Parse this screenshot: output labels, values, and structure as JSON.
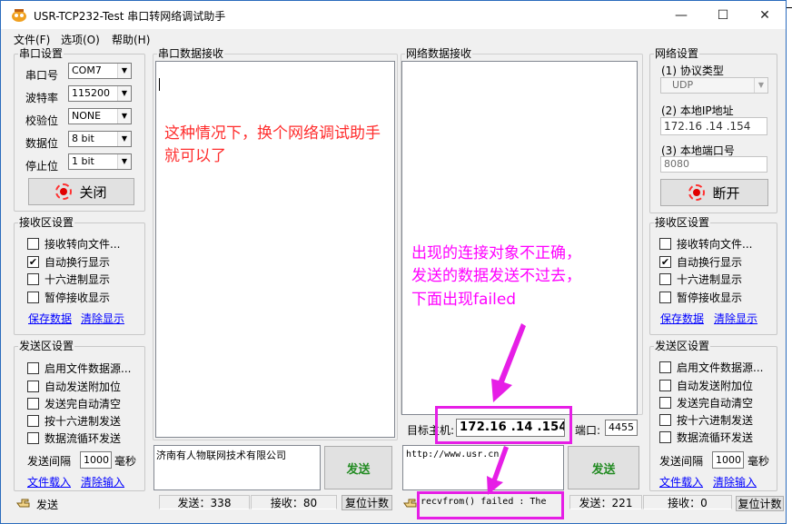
{
  "window": {
    "title": "USR-TCP232-Test 串口转网络调试助手",
    "minimize": "—",
    "maximize": "☐",
    "close": "✕"
  },
  "menu": [
    "文件(F)",
    "选项(O)",
    "帮助(H)"
  ],
  "serial_settings": {
    "legend": "串口设置",
    "rows": [
      {
        "label": "串口号",
        "value": "COM7"
      },
      {
        "label": "波特率",
        "value": "115200"
      },
      {
        "label": "校验位",
        "value": "NONE"
      },
      {
        "label": "数据位",
        "value": "8 bit"
      },
      {
        "label": "停止位",
        "value": "1 bit"
      }
    ],
    "close_button": "关闭"
  },
  "left_receive": {
    "legend": "接收区设置",
    "options": [
      {
        "label": "接收转向文件...",
        "checked": false
      },
      {
        "label": "自动换行显示",
        "checked": true
      },
      {
        "label": "十六进制显示",
        "checked": false
      },
      {
        "label": "暂停接收显示",
        "checked": false
      }
    ],
    "save_link": "保存数据",
    "clear_link": "清除显示"
  },
  "left_send": {
    "legend": "发送区设置",
    "options": [
      {
        "label": "启用文件数据源...",
        "checked": false
      },
      {
        "label": "自动发送附加位",
        "checked": false
      },
      {
        "label": "发送完自动清空",
        "checked": false
      },
      {
        "label": "按十六进制发送",
        "checked": false
      },
      {
        "label": "数据流循环发送",
        "checked": false
      }
    ],
    "interval_label": "发送间隔",
    "interval_value": "1000",
    "interval_unit": "毫秒",
    "load_link": "文件载入",
    "clear_link": "清除输入"
  },
  "serial_receive": {
    "legend": "串口数据接收"
  },
  "net_receive": {
    "legend": "网络数据接收"
  },
  "serial_send": {
    "text": "济南有人物联网技术有限公司",
    "button": "发送"
  },
  "net_send": {
    "text": "http://www.usr.cn",
    "button": "发送"
  },
  "target": {
    "label": "目标主机:",
    "ip": "172.16 .14 .154",
    "port_label": "端口:",
    "port": "4455"
  },
  "net_settings": {
    "legend": "网络设置",
    "protocol_label": "(1) 协议类型",
    "protocol": "UDP",
    "ip_label": "(2) 本地IP地址",
    "ip": "172.16 .14 .154",
    "port_label": "(3) 本地端口号",
    "port": "8080",
    "disconnect_button": "断开"
  },
  "right_receive": {
    "legend": "接收区设置",
    "options": [
      {
        "label": "接收转向文件...",
        "checked": false
      },
      {
        "label": "自动换行显示",
        "checked": true
      },
      {
        "label": "十六进制显示",
        "checked": false
      },
      {
        "label": "暂停接收显示",
        "checked": false
      }
    ],
    "save_link": "保存数据",
    "clear_link": "清除显示"
  },
  "right_send": {
    "legend": "发送区设置",
    "options": [
      {
        "label": "启用文件数据源...",
        "checked": false
      },
      {
        "label": "自动发送附加位",
        "checked": false
      },
      {
        "label": "发送完自动清空",
        "checked": false
      },
      {
        "label": "按十六进制发送",
        "checked": false
      },
      {
        "label": "数据流循环发送",
        "checked": false
      }
    ],
    "interval_label": "发送间隔",
    "interval_value": "1000",
    "interval_unit": "毫秒",
    "load_link": "文件载入",
    "clear_link": "清除输入"
  },
  "statusbar": {
    "left_label": "发送",
    "serial_send": "发送：338",
    "serial_recv": "接收：80",
    "reset1": "复位计数",
    "net_message": "recvfrom() failed : The",
    "net_send": "发送：221",
    "net_recv": "接收：0",
    "reset2": "复位计数"
  },
  "annotations": {
    "red_line1": "这种情况下，换个网络调试助手",
    "red_line2": "就可以了",
    "pink_line1": "出现的连接对象不正确，",
    "pink_line2": "发送的数据发送不过去，",
    "pink_line3": "下面出现failed"
  },
  "colors": {
    "annotation_pink": "#ff00ff",
    "annotation_red": "#ff2d2d",
    "link": "#0000ff",
    "send_button_text": "#228b22"
  },
  "icons": [
    "app-icon",
    "led-icon",
    "hand-icon"
  ]
}
